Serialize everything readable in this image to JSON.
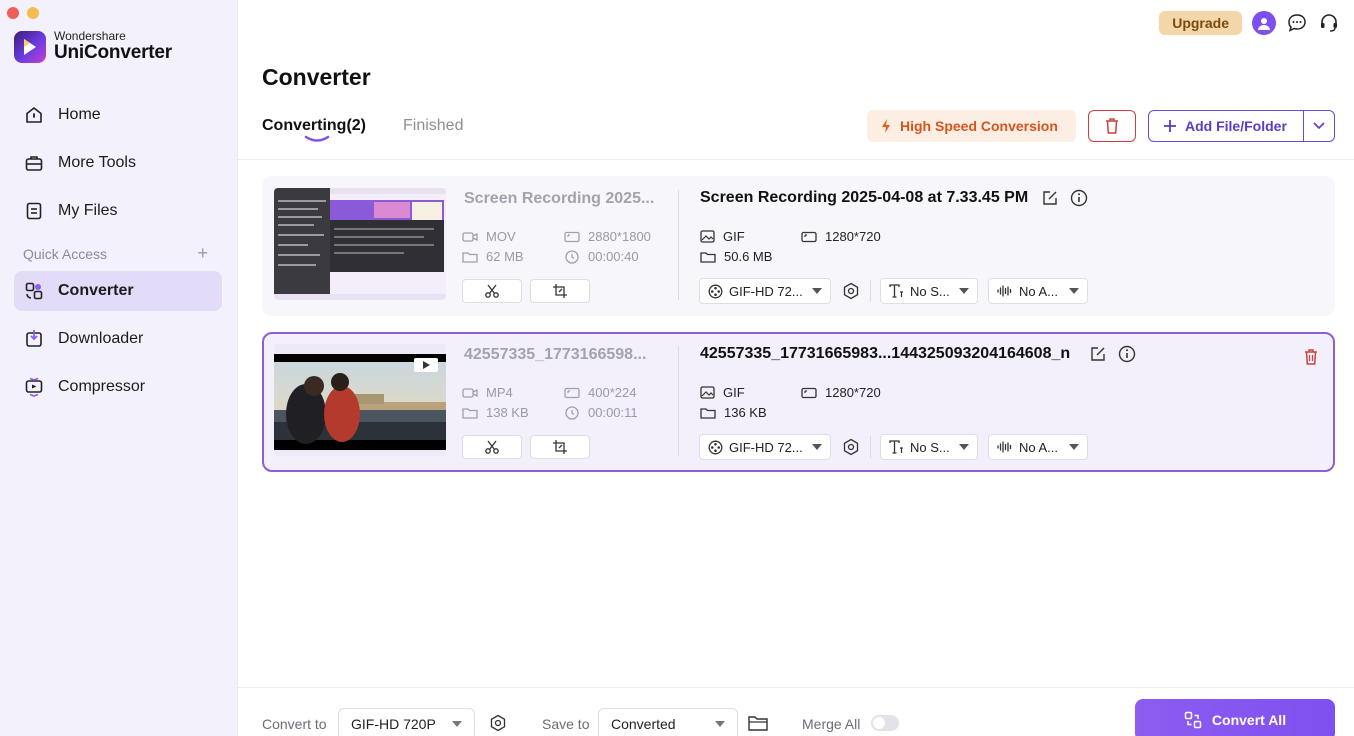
{
  "window": {
    "traffic_colors": [
      "#ee5f57",
      "#f5bd4f",
      "#62c655"
    ]
  },
  "app": {
    "brand_line1": "Wondershare",
    "brand_line2": "UniConverter"
  },
  "sidebar": {
    "items": [
      {
        "label": "Home",
        "icon": "home-icon"
      },
      {
        "label": "More Tools",
        "icon": "toolbox-icon"
      },
      {
        "label": "My Files",
        "icon": "file-icon"
      }
    ],
    "quick_access_label": "Quick Access",
    "quick_items": [
      {
        "label": "Converter",
        "icon": "converter-icon",
        "active": true
      },
      {
        "label": "Downloader",
        "icon": "downloader-icon"
      },
      {
        "label": "Compressor",
        "icon": "compressor-icon"
      }
    ]
  },
  "header": {
    "upgrade_label": "Upgrade",
    "page_title": "Converter",
    "tab_converting": "Converting(2)",
    "tab_finished": "Finished",
    "high_speed_label": "High Speed Conversion",
    "add_file_label": "Add File/Folder"
  },
  "files": [
    {
      "source_name": "Screen Recording 2025...",
      "source_format": "MOV",
      "source_resolution": "2880*1800",
      "source_size": "62 MB",
      "source_duration": "00:00:40",
      "output_name": "Screen Recording 2025-04-08 at 7.33.45 PM",
      "output_format": "GIF",
      "output_resolution": "1280*720",
      "output_size": "50.6 MB",
      "preset": "GIF-HD 72...",
      "subtitle": "No S...",
      "audio": "No A..."
    },
    {
      "source_name": "42557335_1773166598...",
      "source_format": "MP4",
      "source_resolution": "400*224",
      "source_size": "138 KB",
      "source_duration": "00:00:11",
      "output_name": "42557335_17731665983...144325093204164608_n",
      "output_format": "GIF",
      "output_resolution": "1280*720",
      "output_size": "136 KB",
      "preset": "GIF-HD 72...",
      "subtitle": "No S...",
      "audio": "No A..."
    }
  ],
  "bottom": {
    "convert_to_label": "Convert to",
    "convert_to_value": "GIF-HD 720P",
    "save_to_label": "Save to",
    "save_to_value": "Converted",
    "merge_all_label": "Merge All",
    "merge_all_on": false,
    "convert_all_label": "Convert All"
  },
  "colors": {
    "accent": "#7f50ef",
    "sidebar_bg": "#f3f1fb",
    "active_nav": "#e3dcf8",
    "danger": "#c9423e",
    "high_speed": "#d6541d"
  }
}
